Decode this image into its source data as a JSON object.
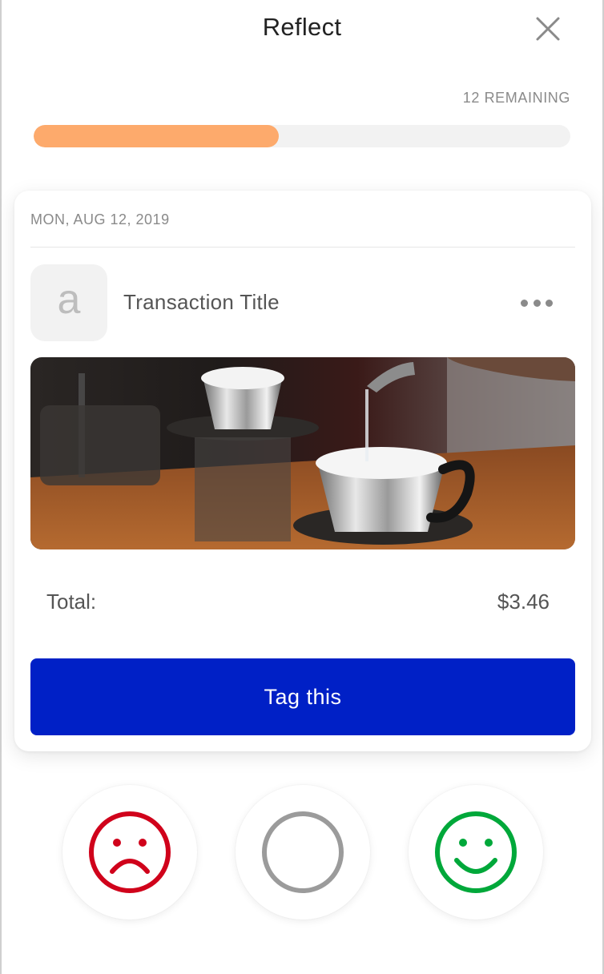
{
  "header": {
    "title": "Reflect",
    "close_icon": "close-icon"
  },
  "progress": {
    "remaining_text": "12 REMAINING",
    "fraction_complete": 0.456,
    "fill_color": "#fdaa6c"
  },
  "card": {
    "date": "MON, AUG 12, 2019",
    "avatar_letter": "a",
    "transaction_title": "Transaction Title",
    "more_icon": "more-horizontal-icon",
    "photo": "coffee-pour-over-photo",
    "total_label": "Total:",
    "total_value": "$3.46",
    "tag_button_label": "Tag this",
    "tag_button_color": "#0020c6"
  },
  "moods": [
    {
      "name": "sad",
      "icon": "sad-face-icon",
      "color": "#d0021b"
    },
    {
      "name": "neutral",
      "icon": "neutral-circle-icon",
      "color": "#9b9b9b"
    },
    {
      "name": "happy",
      "icon": "happy-face-icon",
      "color": "#00a83a"
    }
  ]
}
